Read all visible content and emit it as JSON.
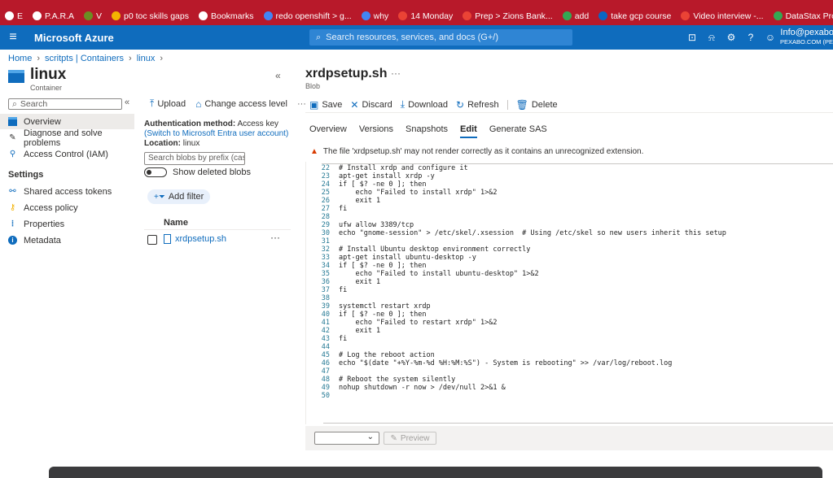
{
  "bookmarks": [
    {
      "label": "E",
      "color": "#ffffff"
    },
    {
      "label": "P.A.R.A",
      "color": "#ffffff"
    },
    {
      "label": "V",
      "color": "#6b8e23"
    },
    {
      "label": "p0 toc skills gaps",
      "color": "#f4b400"
    },
    {
      "label": "Bookmarks",
      "color": "#ffffff"
    },
    {
      "label": "redo openshift > g...",
      "color": "#4285f4"
    },
    {
      "label": "why",
      "color": "#4285f4"
    },
    {
      "label": "14 Monday",
      "color": "#ea4335"
    },
    {
      "label": "Prep > Zions Bank...",
      "color": "#ea4335"
    },
    {
      "label": "add",
      "color": "#34a853"
    },
    {
      "label": "take gcp course",
      "color": "#0a66c2"
    },
    {
      "label": "Video interview -...",
      "color": "#ea4335"
    },
    {
      "label": "DataStax Producti...",
      "color": "#34a853"
    }
  ],
  "bookmarks_more": "»",
  "header": {
    "brand": "Microsoft Azure",
    "search_placeholder": "Search resources, services, and docs (G+/)",
    "account_line1": "Info@pexabo",
    "account_line2": "PEXABO.COM (PEXAB"
  },
  "breadcrumb": [
    "Home",
    "scritpts | Containers",
    "linux"
  ],
  "left_blade": {
    "title": "linux",
    "subtitle": "Container",
    "search_label": "Search",
    "nav": [
      {
        "label": "Overview",
        "icon": "overview-icon",
        "active": true
      },
      {
        "label": "Diagnose and solve problems",
        "icon": "wrench-icon",
        "active": false
      },
      {
        "label": "Access Control (IAM)",
        "icon": "iam-icon",
        "active": false
      }
    ],
    "settings_heading": "Settings",
    "settings_nav": [
      {
        "label": "Shared access tokens",
        "icon": "link-icon"
      },
      {
        "label": "Access policy",
        "icon": "key-icon"
      },
      {
        "label": "Properties",
        "icon": "properties-icon"
      },
      {
        "label": "Metadata",
        "icon": "info-icon"
      }
    ]
  },
  "mid": {
    "upload": "Upload",
    "change_access": "Change access level",
    "more": "···",
    "auth_label": "Authentication method:",
    "auth_value": " Access key ",
    "auth_link": "(Switch to Microsoft Entra user account)",
    "location_label": "Location:",
    "location_value": " linux",
    "blob_prefix_placeholder": "Search blobs by prefix (case-...",
    "show_deleted": "Show deleted blobs",
    "add_filter": "Add filter",
    "name_header": "Name",
    "file_name": "xrdpsetup.sh",
    "file_more": "···"
  },
  "right": {
    "title": "xrdpsetup.sh",
    "title_more": "···",
    "subtitle": "Blob",
    "toolbar": {
      "save": "Save",
      "discard": "Discard",
      "download": "Download",
      "refresh": "Refresh",
      "delete": "Delete"
    },
    "tabs": [
      "Overview",
      "Versions",
      "Snapshots",
      "Edit",
      "Generate SAS"
    ],
    "active_tab": "Edit",
    "warning": "The file 'xrdpsetup.sh' may not render correctly as it contains an unrecognized extension.",
    "preview": "Preview"
  },
  "code_lines": [
    {
      "n": "22",
      "t": "# Install xrdp and configure it"
    },
    {
      "n": "23",
      "t": "apt-get install xrdp -y"
    },
    {
      "n": "24",
      "t": "if [ $? -ne 0 ]; then"
    },
    {
      "n": "25",
      "t": "    echo \"Failed to install xrdp\" 1>&2"
    },
    {
      "n": "26",
      "t": "    exit 1"
    },
    {
      "n": "27",
      "t": "fi"
    },
    {
      "n": "28",
      "t": ""
    },
    {
      "n": "29",
      "t": "ufw allow 3389/tcp"
    },
    {
      "n": "30",
      "t": "echo \"gnome-session\" > /etc/skel/.xsession  # Using /etc/skel so new users inherit this setup"
    },
    {
      "n": "31",
      "t": ""
    },
    {
      "n": "32",
      "t": "# Install Ubuntu desktop environment correctly"
    },
    {
      "n": "33",
      "t": "apt-get install ubuntu-desktop -y"
    },
    {
      "n": "34",
      "t": "if [ $? -ne 0 ]; then"
    },
    {
      "n": "35",
      "t": "    echo \"Failed to install ubuntu-desktop\" 1>&2"
    },
    {
      "n": "36",
      "t": "    exit 1"
    },
    {
      "n": "37",
      "t": "fi"
    },
    {
      "n": "38",
      "t": ""
    },
    {
      "n": "39",
      "t": "systemctl restart xrdp"
    },
    {
      "n": "40",
      "t": "if [ $? -ne 0 ]; then"
    },
    {
      "n": "41",
      "t": "    echo \"Failed to restart xrdp\" 1>&2"
    },
    {
      "n": "42",
      "t": "    exit 1"
    },
    {
      "n": "43",
      "t": "fi"
    },
    {
      "n": "44",
      "t": ""
    },
    {
      "n": "45",
      "t": "# Log the reboot action"
    },
    {
      "n": "46",
      "t": "echo \"$(date \"+%Y-%m-%d %H:%M:%S\") - System is rebooting\" >> /var/log/reboot.log"
    },
    {
      "n": "47",
      "t": ""
    },
    {
      "n": "48",
      "t": "# Reboot the system silently"
    },
    {
      "n": "49",
      "t": "nohup shutdown -r now > /dev/null 2>&1 &"
    },
    {
      "n": "50",
      "t": ""
    }
  ]
}
